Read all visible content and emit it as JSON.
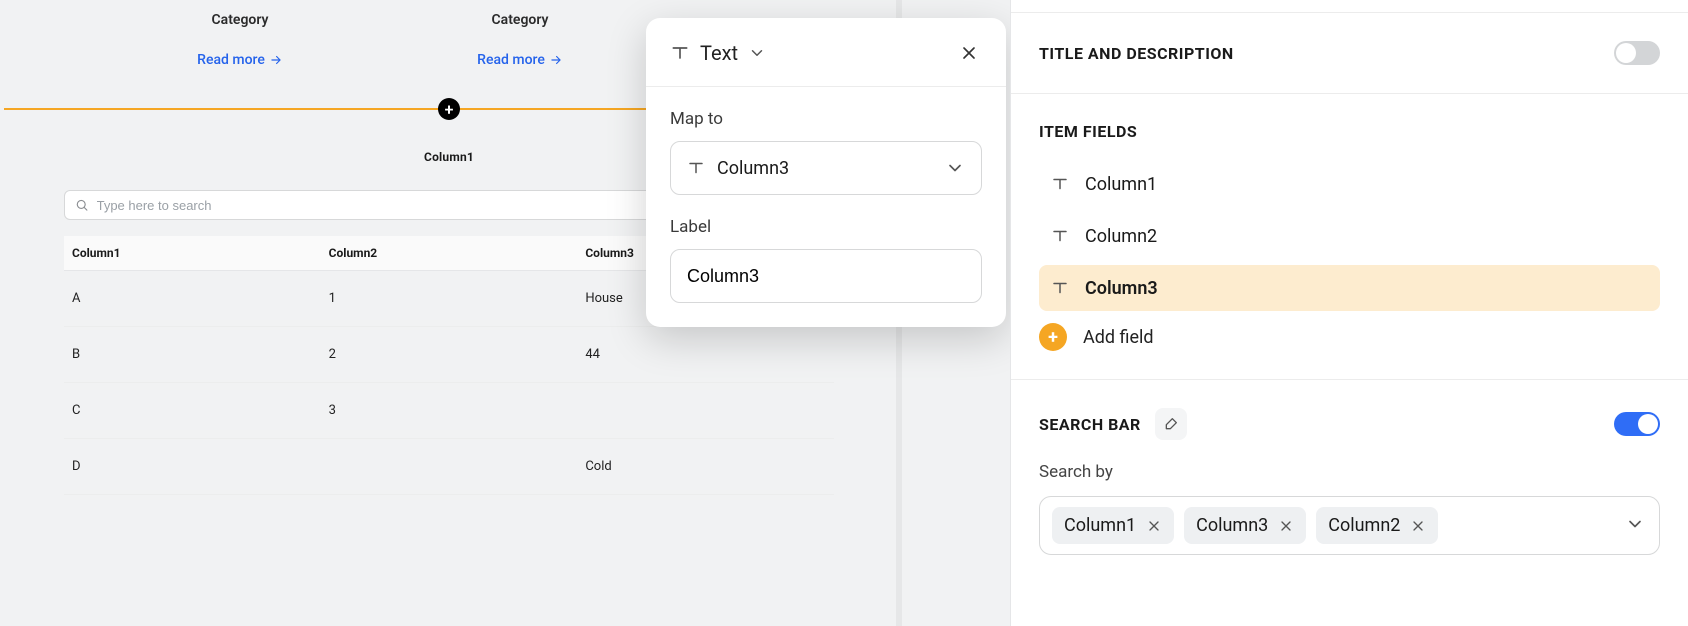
{
  "cards": [
    {
      "category": "Category",
      "readmore": "Read more"
    },
    {
      "category": "Category",
      "readmore": "Read more"
    }
  ],
  "table": {
    "title": "Column1",
    "search_placeholder": "Type here to search",
    "columns": [
      "Column1",
      "Column2",
      "Column3"
    ],
    "rows": [
      {
        "c1": "A",
        "c2": "1",
        "c3": "House"
      },
      {
        "c1": "B",
        "c2": "2",
        "c3": "44"
      },
      {
        "c1": "C",
        "c2": "3",
        "c3": ""
      },
      {
        "c1": "D",
        "c2": "",
        "c3": "Cold"
      }
    ]
  },
  "popover": {
    "type_label": "Text",
    "mapto_label": "Map to",
    "mapto_value": "Column3",
    "label_label": "Label",
    "label_value": "Column3"
  },
  "panel": {
    "title_desc": {
      "heading": "TITLE AND DESCRIPTION",
      "enabled": false
    },
    "item_fields": {
      "heading": "ITEM FIELDS",
      "items": [
        "Column1",
        "Column2",
        "Column3"
      ],
      "active_index": 2,
      "add_label": "Add field"
    },
    "search_bar": {
      "heading": "SEARCH BAR",
      "enabled": true,
      "search_by_label": "Search by",
      "chips": [
        "Column1",
        "Column3",
        "Column2"
      ]
    }
  }
}
